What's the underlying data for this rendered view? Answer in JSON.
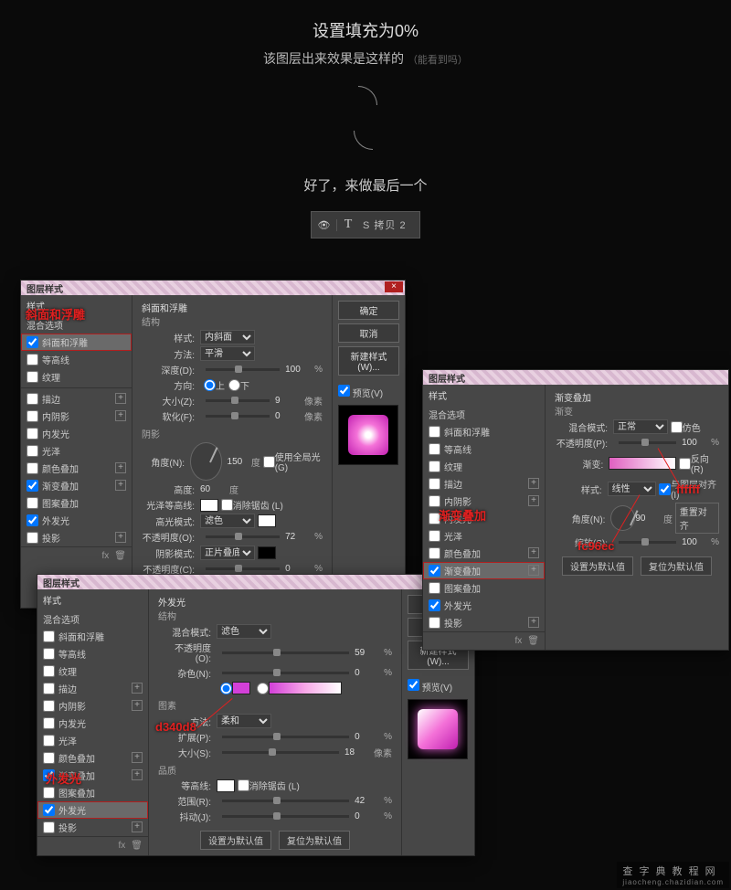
{
  "hdr": {
    "t1": "设置填充为0%",
    "t2": "该图层出来效果是这样的",
    "hint": "（能看到吗）",
    "sub": "好了，来做最后一个"
  },
  "chip": {
    "eye": "👁",
    "t": "T",
    "name": "S 拷贝 2"
  },
  "dlg": {
    "title": "图层样式"
  },
  "btns": {
    "ok": "确定",
    "cancel": "取消",
    "new": "新建样式 (W)...",
    "preview": "预览(V)",
    "def": "设置为默认值",
    "reset": "复位为默认值"
  },
  "styles": {
    "hdr": "样式",
    "混合选项": "混合选项",
    "斜面和浮雕": "斜面和浮雕",
    "等高线": "等高线",
    "纹理": "纹理",
    "描边": "描边",
    "内阴影": "内阴影",
    "内发光": "内发光",
    "光泽": "光泽",
    "颜色叠加": "颜色叠加",
    "渐变叠加": "渐变叠加",
    "图案叠加": "图案叠加",
    "外发光": "外发光",
    "投影": "投影"
  },
  "bevel": {
    "section": "斜面和浮雕",
    "struct": "结构",
    "shade": "阴影",
    "style_k": "样式:",
    "style_v": "内斜面",
    "method_k": "方法:",
    "method_v": "平滑",
    "depth_k": "深度(D):",
    "depth_v": "100",
    "pct": "%",
    "dir_k": "方向:",
    "up": "上",
    "down": "下",
    "size_k": "大小(Z):",
    "size_v": "9",
    "px": "像素",
    "soft_k": "软化(F):",
    "soft_v": "0",
    "angle_k": "角度(N):",
    "angle_v": "150",
    "deg": "度",
    "global": "使用全局光(G)",
    "alt_k": "高度:",
    "alt_v": "60",
    "contour_k": "光泽等高线:",
    "anti": "消除锯齿 (L)",
    "hmode_k": "高光模式:",
    "hmode_v": "滤色",
    "hop_k": "不透明度(O):",
    "hop_v": "72",
    "smode_k": "阴影模式:",
    "smode_v": "正片叠底",
    "sop_k": "不透明度(C):",
    "sop_v": "0"
  },
  "glow": {
    "section": "外发光",
    "struct": "结构",
    "elem": "图素",
    "qual": "品质",
    "bmode_k": "混合模式:",
    "bmode_v": "滤色",
    "op_k": "不透明度 (O):",
    "op_v": "59",
    "pct": "%",
    "noise_k": "杂色(N):",
    "noise_v": "0",
    "method_k": "方法:",
    "method_v": "柔和",
    "spread_k": "扩展(P):",
    "spread_v": "0",
    "size_k": "大小(S):",
    "size_v": "18",
    "px": "像素",
    "contour_k": "等高线:",
    "anti": "消除锯齿 (L)",
    "range_k": "范围(R):",
    "range_v": "42",
    "jitter_k": "抖动(J):",
    "jitter_v": "0"
  },
  "grad": {
    "section": "渐变叠加",
    "sub": "渐变",
    "bmode_k": "混合模式:",
    "bmode_v": "正常",
    "dither": "仿色",
    "op_k": "不透明度(P):",
    "op_v": "100",
    "pct": "%",
    "grad_k": "渐变:",
    "rev": "反向(R)",
    "style_k": "样式:",
    "style_v": "线性",
    "align": "与图层对齐(I)",
    "angle_k": "角度(N):",
    "angle_v": "90",
    "deg": "度",
    "reset": "重置对齐",
    "scale_k": "缩放(S):",
    "scale_v": "100"
  },
  "anno": {
    "a1": "斜面和浮雕",
    "a2": "外发光",
    "a2c": "d340d8",
    "a3": "渐变叠加",
    "a3c": "fc96ec",
    "a3c2": "ffffff"
  },
  "watermark": {
    "t": "查 字 典 教 程 网",
    "u": "jiaocheng.chazidian.com"
  }
}
